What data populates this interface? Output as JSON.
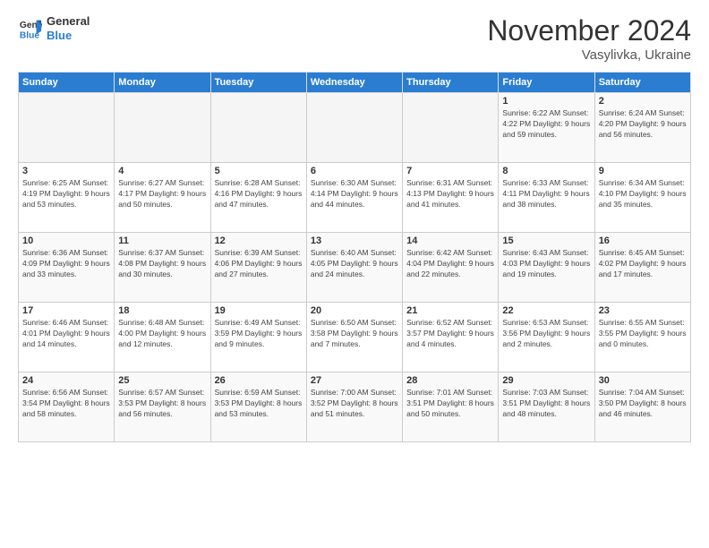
{
  "logo": {
    "text_general": "General",
    "text_blue": "Blue"
  },
  "title": "November 2024",
  "subtitle": "Vasylivka, Ukraine",
  "days_of_week": [
    "Sunday",
    "Monday",
    "Tuesday",
    "Wednesday",
    "Thursday",
    "Friday",
    "Saturday"
  ],
  "weeks": [
    [
      {
        "day": "",
        "info": ""
      },
      {
        "day": "",
        "info": ""
      },
      {
        "day": "",
        "info": ""
      },
      {
        "day": "",
        "info": ""
      },
      {
        "day": "",
        "info": ""
      },
      {
        "day": "1",
        "info": "Sunrise: 6:22 AM\nSunset: 4:22 PM\nDaylight: 9 hours and 59 minutes."
      },
      {
        "day": "2",
        "info": "Sunrise: 6:24 AM\nSunset: 4:20 PM\nDaylight: 9 hours and 56 minutes."
      }
    ],
    [
      {
        "day": "3",
        "info": "Sunrise: 6:25 AM\nSunset: 4:19 PM\nDaylight: 9 hours and 53 minutes."
      },
      {
        "day": "4",
        "info": "Sunrise: 6:27 AM\nSunset: 4:17 PM\nDaylight: 9 hours and 50 minutes."
      },
      {
        "day": "5",
        "info": "Sunrise: 6:28 AM\nSunset: 4:16 PM\nDaylight: 9 hours and 47 minutes."
      },
      {
        "day": "6",
        "info": "Sunrise: 6:30 AM\nSunset: 4:14 PM\nDaylight: 9 hours and 44 minutes."
      },
      {
        "day": "7",
        "info": "Sunrise: 6:31 AM\nSunset: 4:13 PM\nDaylight: 9 hours and 41 minutes."
      },
      {
        "day": "8",
        "info": "Sunrise: 6:33 AM\nSunset: 4:11 PM\nDaylight: 9 hours and 38 minutes."
      },
      {
        "day": "9",
        "info": "Sunrise: 6:34 AM\nSunset: 4:10 PM\nDaylight: 9 hours and 35 minutes."
      }
    ],
    [
      {
        "day": "10",
        "info": "Sunrise: 6:36 AM\nSunset: 4:09 PM\nDaylight: 9 hours and 33 minutes."
      },
      {
        "day": "11",
        "info": "Sunrise: 6:37 AM\nSunset: 4:08 PM\nDaylight: 9 hours and 30 minutes."
      },
      {
        "day": "12",
        "info": "Sunrise: 6:39 AM\nSunset: 4:06 PM\nDaylight: 9 hours and 27 minutes."
      },
      {
        "day": "13",
        "info": "Sunrise: 6:40 AM\nSunset: 4:05 PM\nDaylight: 9 hours and 24 minutes."
      },
      {
        "day": "14",
        "info": "Sunrise: 6:42 AM\nSunset: 4:04 PM\nDaylight: 9 hours and 22 minutes."
      },
      {
        "day": "15",
        "info": "Sunrise: 6:43 AM\nSunset: 4:03 PM\nDaylight: 9 hours and 19 minutes."
      },
      {
        "day": "16",
        "info": "Sunrise: 6:45 AM\nSunset: 4:02 PM\nDaylight: 9 hours and 17 minutes."
      }
    ],
    [
      {
        "day": "17",
        "info": "Sunrise: 6:46 AM\nSunset: 4:01 PM\nDaylight: 9 hours and 14 minutes."
      },
      {
        "day": "18",
        "info": "Sunrise: 6:48 AM\nSunset: 4:00 PM\nDaylight: 9 hours and 12 minutes."
      },
      {
        "day": "19",
        "info": "Sunrise: 6:49 AM\nSunset: 3:59 PM\nDaylight: 9 hours and 9 minutes."
      },
      {
        "day": "20",
        "info": "Sunrise: 6:50 AM\nSunset: 3:58 PM\nDaylight: 9 hours and 7 minutes."
      },
      {
        "day": "21",
        "info": "Sunrise: 6:52 AM\nSunset: 3:57 PM\nDaylight: 9 hours and 4 minutes."
      },
      {
        "day": "22",
        "info": "Sunrise: 6:53 AM\nSunset: 3:56 PM\nDaylight: 9 hours and 2 minutes."
      },
      {
        "day": "23",
        "info": "Sunrise: 6:55 AM\nSunset: 3:55 PM\nDaylight: 9 hours and 0 minutes."
      }
    ],
    [
      {
        "day": "24",
        "info": "Sunrise: 6:56 AM\nSunset: 3:54 PM\nDaylight: 8 hours and 58 minutes."
      },
      {
        "day": "25",
        "info": "Sunrise: 6:57 AM\nSunset: 3:53 PM\nDaylight: 8 hours and 56 minutes."
      },
      {
        "day": "26",
        "info": "Sunrise: 6:59 AM\nSunset: 3:53 PM\nDaylight: 8 hours and 53 minutes."
      },
      {
        "day": "27",
        "info": "Sunrise: 7:00 AM\nSunset: 3:52 PM\nDaylight: 8 hours and 51 minutes."
      },
      {
        "day": "28",
        "info": "Sunrise: 7:01 AM\nSunset: 3:51 PM\nDaylight: 8 hours and 50 minutes."
      },
      {
        "day": "29",
        "info": "Sunrise: 7:03 AM\nSunset: 3:51 PM\nDaylight: 8 hours and 48 minutes."
      },
      {
        "day": "30",
        "info": "Sunrise: 7:04 AM\nSunset: 3:50 PM\nDaylight: 8 hours and 46 minutes."
      }
    ]
  ]
}
